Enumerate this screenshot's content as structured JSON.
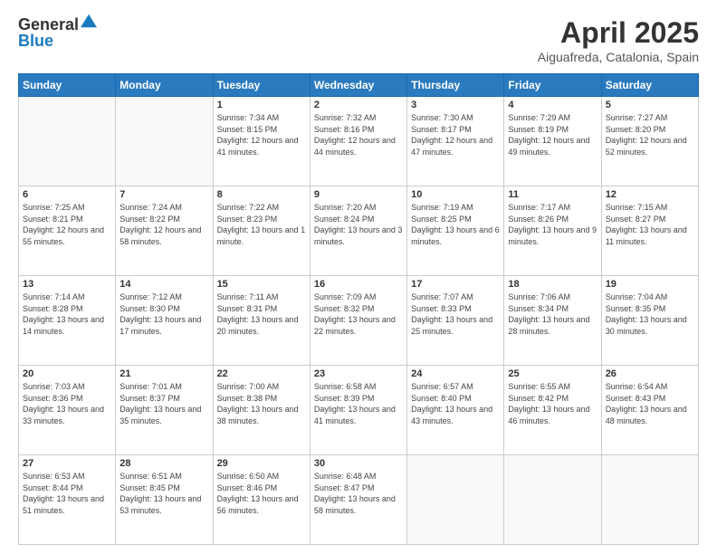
{
  "logo": {
    "general": "General",
    "blue": "Blue"
  },
  "header": {
    "title": "April 2025",
    "location": "Aiguafreda, Catalonia, Spain"
  },
  "weekdays": [
    "Sunday",
    "Monday",
    "Tuesday",
    "Wednesday",
    "Thursday",
    "Friday",
    "Saturday"
  ],
  "weeks": [
    [
      {
        "day": "",
        "info": ""
      },
      {
        "day": "",
        "info": ""
      },
      {
        "day": "1",
        "info": "Sunrise: 7:34 AM\nSunset: 8:15 PM\nDaylight: 12 hours and 41 minutes."
      },
      {
        "day": "2",
        "info": "Sunrise: 7:32 AM\nSunset: 8:16 PM\nDaylight: 12 hours and 44 minutes."
      },
      {
        "day": "3",
        "info": "Sunrise: 7:30 AM\nSunset: 8:17 PM\nDaylight: 12 hours and 47 minutes."
      },
      {
        "day": "4",
        "info": "Sunrise: 7:29 AM\nSunset: 8:19 PM\nDaylight: 12 hours and 49 minutes."
      },
      {
        "day": "5",
        "info": "Sunrise: 7:27 AM\nSunset: 8:20 PM\nDaylight: 12 hours and 52 minutes."
      }
    ],
    [
      {
        "day": "6",
        "info": "Sunrise: 7:25 AM\nSunset: 8:21 PM\nDaylight: 12 hours and 55 minutes."
      },
      {
        "day": "7",
        "info": "Sunrise: 7:24 AM\nSunset: 8:22 PM\nDaylight: 12 hours and 58 minutes."
      },
      {
        "day": "8",
        "info": "Sunrise: 7:22 AM\nSunset: 8:23 PM\nDaylight: 13 hours and 1 minute."
      },
      {
        "day": "9",
        "info": "Sunrise: 7:20 AM\nSunset: 8:24 PM\nDaylight: 13 hours and 3 minutes."
      },
      {
        "day": "10",
        "info": "Sunrise: 7:19 AM\nSunset: 8:25 PM\nDaylight: 13 hours and 6 minutes."
      },
      {
        "day": "11",
        "info": "Sunrise: 7:17 AM\nSunset: 8:26 PM\nDaylight: 13 hours and 9 minutes."
      },
      {
        "day": "12",
        "info": "Sunrise: 7:15 AM\nSunset: 8:27 PM\nDaylight: 13 hours and 11 minutes."
      }
    ],
    [
      {
        "day": "13",
        "info": "Sunrise: 7:14 AM\nSunset: 8:28 PM\nDaylight: 13 hours and 14 minutes."
      },
      {
        "day": "14",
        "info": "Sunrise: 7:12 AM\nSunset: 8:30 PM\nDaylight: 13 hours and 17 minutes."
      },
      {
        "day": "15",
        "info": "Sunrise: 7:11 AM\nSunset: 8:31 PM\nDaylight: 13 hours and 20 minutes."
      },
      {
        "day": "16",
        "info": "Sunrise: 7:09 AM\nSunset: 8:32 PM\nDaylight: 13 hours and 22 minutes."
      },
      {
        "day": "17",
        "info": "Sunrise: 7:07 AM\nSunset: 8:33 PM\nDaylight: 13 hours and 25 minutes."
      },
      {
        "day": "18",
        "info": "Sunrise: 7:06 AM\nSunset: 8:34 PM\nDaylight: 13 hours and 28 minutes."
      },
      {
        "day": "19",
        "info": "Sunrise: 7:04 AM\nSunset: 8:35 PM\nDaylight: 13 hours and 30 minutes."
      }
    ],
    [
      {
        "day": "20",
        "info": "Sunrise: 7:03 AM\nSunset: 8:36 PM\nDaylight: 13 hours and 33 minutes."
      },
      {
        "day": "21",
        "info": "Sunrise: 7:01 AM\nSunset: 8:37 PM\nDaylight: 13 hours and 35 minutes."
      },
      {
        "day": "22",
        "info": "Sunrise: 7:00 AM\nSunset: 8:38 PM\nDaylight: 13 hours and 38 minutes."
      },
      {
        "day": "23",
        "info": "Sunrise: 6:58 AM\nSunset: 8:39 PM\nDaylight: 13 hours and 41 minutes."
      },
      {
        "day": "24",
        "info": "Sunrise: 6:57 AM\nSunset: 8:40 PM\nDaylight: 13 hours and 43 minutes."
      },
      {
        "day": "25",
        "info": "Sunrise: 6:55 AM\nSunset: 8:42 PM\nDaylight: 13 hours and 46 minutes."
      },
      {
        "day": "26",
        "info": "Sunrise: 6:54 AM\nSunset: 8:43 PM\nDaylight: 13 hours and 48 minutes."
      }
    ],
    [
      {
        "day": "27",
        "info": "Sunrise: 6:53 AM\nSunset: 8:44 PM\nDaylight: 13 hours and 51 minutes."
      },
      {
        "day": "28",
        "info": "Sunrise: 6:51 AM\nSunset: 8:45 PM\nDaylight: 13 hours and 53 minutes."
      },
      {
        "day": "29",
        "info": "Sunrise: 6:50 AM\nSunset: 8:46 PM\nDaylight: 13 hours and 56 minutes."
      },
      {
        "day": "30",
        "info": "Sunrise: 6:48 AM\nSunset: 8:47 PM\nDaylight: 13 hours and 58 minutes."
      },
      {
        "day": "",
        "info": ""
      },
      {
        "day": "",
        "info": ""
      },
      {
        "day": "",
        "info": ""
      }
    ]
  ]
}
